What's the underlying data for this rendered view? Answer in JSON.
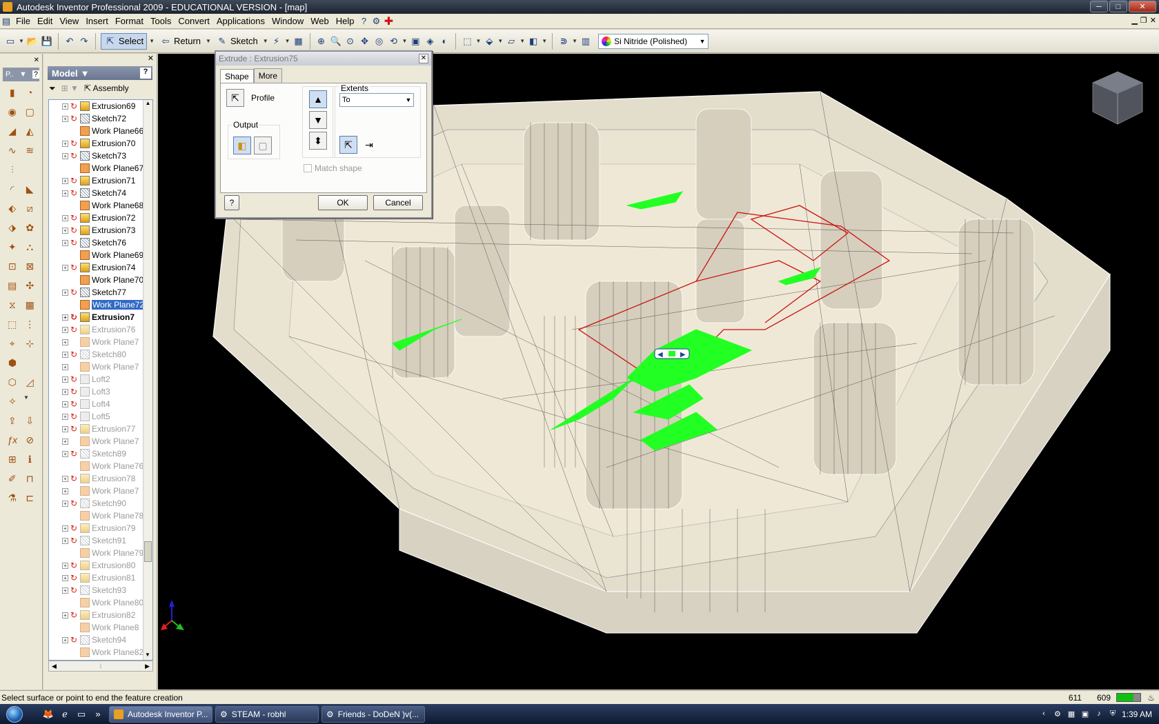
{
  "window": {
    "title": "Autodesk Inventor Professional 2009 - EDUCATIONAL VERSION - [map]",
    "min": "─",
    "max": "□",
    "close": "✕"
  },
  "menu": [
    "File",
    "Edit",
    "View",
    "Insert",
    "Format",
    "Tools",
    "Convert",
    "Applications",
    "Window",
    "Web",
    "Help"
  ],
  "toolbar": {
    "select": "Select",
    "return": "Return",
    "sketch": "Sketch",
    "material": "Si Nitride (Polished)"
  },
  "leftstrip": {
    "selector": "P.."
  },
  "browser": {
    "title": "Model",
    "assembly_label": "Assembly",
    "items": [
      {
        "label": "Extrusion69",
        "kind": "extrude",
        "expand": true,
        "state": "normal"
      },
      {
        "label": "Sketch72",
        "kind": "sketch",
        "expand": true,
        "state": "normal"
      },
      {
        "label": "Work Plane66",
        "kind": "plane",
        "expand": false,
        "state": "normal"
      },
      {
        "label": "Extrusion70",
        "kind": "extrude",
        "expand": true,
        "state": "normal"
      },
      {
        "label": "Sketch73",
        "kind": "sketch",
        "expand": true,
        "state": "normal"
      },
      {
        "label": "Work Plane67",
        "kind": "plane",
        "expand": false,
        "state": "normal"
      },
      {
        "label": "Extrusion71",
        "kind": "extrude",
        "expand": true,
        "state": "normal"
      },
      {
        "label": "Sketch74",
        "kind": "sketch",
        "expand": true,
        "state": "normal"
      },
      {
        "label": "Work Plane68",
        "kind": "plane",
        "expand": false,
        "state": "normal"
      },
      {
        "label": "Extrusion72",
        "kind": "extrude",
        "expand": true,
        "state": "normal"
      },
      {
        "label": "Extrusion73",
        "kind": "extrude",
        "expand": true,
        "state": "normal"
      },
      {
        "label": "Sketch76",
        "kind": "sketch",
        "expand": true,
        "state": "normal"
      },
      {
        "label": "Work Plane69",
        "kind": "plane",
        "expand": false,
        "state": "normal"
      },
      {
        "label": "Extrusion74",
        "kind": "extrude",
        "expand": true,
        "state": "normal"
      },
      {
        "label": "Work Plane70",
        "kind": "plane",
        "expand": false,
        "state": "normal"
      },
      {
        "label": "Sketch77",
        "kind": "sketch",
        "expand": true,
        "state": "normal"
      },
      {
        "label": "Work Plane72",
        "kind": "plane",
        "expand": false,
        "state": "selected"
      },
      {
        "label": "Extrusion7",
        "kind": "extrude",
        "expand": true,
        "state": "bold"
      },
      {
        "label": "Extrusion76",
        "kind": "extrude",
        "expand": true,
        "state": "dim"
      },
      {
        "label": "Work Plane7",
        "kind": "plane",
        "expand": true,
        "state": "dim"
      },
      {
        "label": "Sketch80",
        "kind": "sketch",
        "expand": true,
        "state": "dim"
      },
      {
        "label": "Work Plane7",
        "kind": "plane",
        "expand": true,
        "state": "dim"
      },
      {
        "label": "Loft2",
        "kind": "loft",
        "expand": true,
        "state": "dim"
      },
      {
        "label": "Loft3",
        "kind": "loft",
        "expand": true,
        "state": "dim"
      },
      {
        "label": "Loft4",
        "kind": "loft",
        "expand": true,
        "state": "dim"
      },
      {
        "label": "Loft5",
        "kind": "loft",
        "expand": true,
        "state": "dim"
      },
      {
        "label": "Extrusion77",
        "kind": "extrude",
        "expand": true,
        "state": "dim"
      },
      {
        "label": "Work Plane7",
        "kind": "plane",
        "expand": true,
        "state": "dim"
      },
      {
        "label": "Sketch89",
        "kind": "sketch",
        "expand": true,
        "state": "dim"
      },
      {
        "label": "Work Plane76",
        "kind": "plane",
        "expand": false,
        "state": "dim"
      },
      {
        "label": "Extrusion78",
        "kind": "extrude",
        "expand": true,
        "state": "dim"
      },
      {
        "label": "Work Plane7",
        "kind": "plane",
        "expand": true,
        "state": "dim"
      },
      {
        "label": "Sketch90",
        "kind": "sketch",
        "expand": true,
        "state": "dim"
      },
      {
        "label": "Work Plane78",
        "kind": "plane",
        "expand": false,
        "state": "dim"
      },
      {
        "label": "Extrusion79",
        "kind": "extrude",
        "expand": true,
        "state": "dim"
      },
      {
        "label": "Sketch91",
        "kind": "sketch",
        "expand": true,
        "state": "dim"
      },
      {
        "label": "Work Plane79",
        "kind": "plane",
        "expand": false,
        "state": "dim"
      },
      {
        "label": "Extrusion80",
        "kind": "extrude",
        "expand": true,
        "state": "dim"
      },
      {
        "label": "Extrusion81",
        "kind": "extrude",
        "expand": true,
        "state": "dim"
      },
      {
        "label": "Sketch93",
        "kind": "sketch",
        "expand": true,
        "state": "dim"
      },
      {
        "label": "Work Plane80",
        "kind": "plane",
        "expand": false,
        "state": "dim"
      },
      {
        "label": "Extrusion82",
        "kind": "extrude",
        "expand": true,
        "state": "dim"
      },
      {
        "label": "Work Plane8",
        "kind": "plane",
        "expand": false,
        "state": "dim"
      },
      {
        "label": "Sketch94",
        "kind": "sketch",
        "expand": true,
        "state": "dim"
      },
      {
        "label": "Work Plane82",
        "kind": "plane",
        "expand": false,
        "state": "dim"
      }
    ]
  },
  "dialog": {
    "title": "Extrude : Extrusion75",
    "close": "✕",
    "tabs": [
      "Shape",
      "More"
    ],
    "profile_label": "Profile",
    "output_label": "Output",
    "extents_label": "Extents",
    "extents_value": "To",
    "match_shape_label": "Match shape",
    "help": "?",
    "ok": "OK",
    "cancel": "Cancel"
  },
  "status": {
    "message": "Select surface or point to end the feature creation",
    "x": "611",
    "y": "609"
  },
  "taskbar": {
    "buttons": [
      "Autodesk Inventor P...",
      "STEAM - robhl",
      "Friends - DoDeN )v(..."
    ],
    "clock": "1:39 AM"
  },
  "colors": {
    "selection_green": "#22ff22",
    "edge_red": "#cc1010",
    "model_fill": "#e6e0d0"
  }
}
